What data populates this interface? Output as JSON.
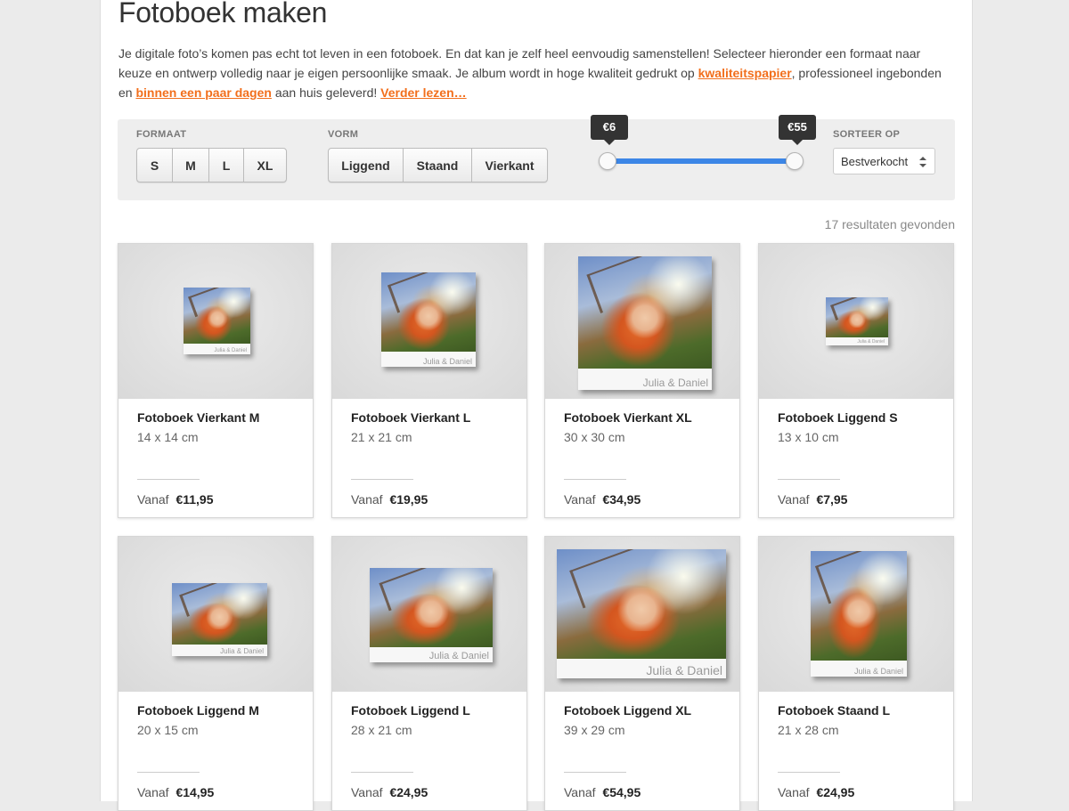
{
  "page": {
    "title": "Fotoboek maken",
    "intro": {
      "part1": "Je digitale foto’s komen pas echt tot leven in een fotoboek. En dat kan je zelf heel eenvoudig samenstellen! Selecteer hieronder een formaat naar keuze en ontwerp volledig naar je eigen persoonlijke smaak. Je album wordt in hoge kwaliteit gedrukt op ",
      "link1": "kwaliteitspapier",
      "part2": ", professioneel ingebonden en ",
      "link2": "binnen een paar dagen",
      "part3": " aan huis geleverd! ",
      "link3": "Verder lezen…"
    }
  },
  "filters": {
    "formaat_label": "FORMAAT",
    "formaat_options": [
      "S",
      "M",
      "L",
      "XL"
    ],
    "vorm_label": "VORM",
    "vorm_options": [
      "Liggend",
      "Staand",
      "Vierkant"
    ],
    "price_min": "€6",
    "price_max": "€55",
    "sort_label": "SORTEER OP",
    "sort_value": "Bestverkocht"
  },
  "results_text": "17 resultaten gevonden",
  "price_prefix": "Vanaf",
  "products": [
    {
      "name": "Fotoboek Vierkant M",
      "size": "14 x 14 cm",
      "price": "€11,95",
      "cover_text": "Julia & Daniel"
    },
    {
      "name": "Fotoboek Vierkant L",
      "size": "21 x 21 cm",
      "price": "€19,95",
      "cover_text": "Julia & Daniel"
    },
    {
      "name": "Fotoboek Vierkant XL",
      "size": "30 x 30 cm",
      "price": "€34,95",
      "cover_text": "Julia & Daniel"
    },
    {
      "name": "Fotoboek Liggend S",
      "size": "13 x 10 cm",
      "price": "€7,95",
      "cover_text": "Julia & Daniel"
    },
    {
      "name": "Fotoboek Liggend M",
      "size": "20 x 15 cm",
      "price": "€14,95",
      "cover_text": "Julia & Daniel"
    },
    {
      "name": "Fotoboek Liggend L",
      "size": "28 x 21 cm",
      "price": "€24,95",
      "cover_text": "Julia & Daniel"
    },
    {
      "name": "Fotoboek Liggend XL",
      "size": "39 x 29 cm",
      "price": "€54,95",
      "cover_text": "Julia & Daniel"
    },
    {
      "name": "Fotoboek Staand L",
      "size": "21 x 28 cm",
      "price": "€24,95",
      "cover_text": "Julia & Daniel"
    }
  ],
  "colors": {
    "accent_link": "#f26f1c",
    "slider": "#3c86e6",
    "tooltip": "#333333"
  }
}
